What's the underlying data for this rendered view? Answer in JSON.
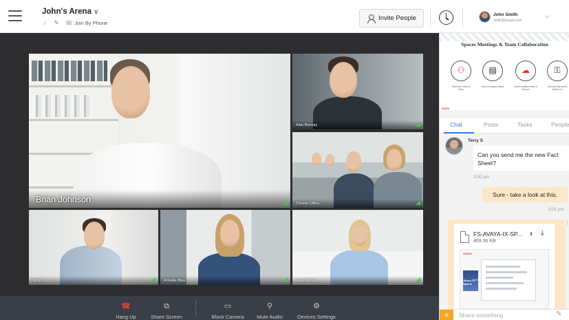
{
  "header": {
    "space_title": "John's Arena",
    "join_by_phone": "Join By Phone",
    "invite_label": "Invite People",
    "user_name": "John Smith",
    "user_email": "smith@avaya.com"
  },
  "video": {
    "main_speaker": "Brian Johnson",
    "tiles": [
      "Alan Bonnay",
      "Toronto Office",
      "Terry S",
      "Annette Blue",
      "Jane Porter"
    ]
  },
  "controls": [
    {
      "label": "Hang Up",
      "icon": "phone-hangup-icon"
    },
    {
      "label": "Share Screen",
      "icon": "share-screen-icon"
    },
    {
      "label": "Block Camera",
      "icon": "camera-icon"
    },
    {
      "label": "Mute Audio",
      "icon": "microphone-icon"
    },
    {
      "label": "Devices Settings",
      "icon": "gear-icon"
    }
  ],
  "banner": {
    "title": "Spaces Meetings & Team Collaboration",
    "features": [
      "Real-time voice & video",
      "Chat for today's teams",
      "Cloud enables ease of access",
      "Security that teams depend on"
    ],
    "brand": "AVAYA"
  },
  "tabs": [
    "Chat",
    "Posts",
    "Tasks",
    "People"
  ],
  "chat": {
    "sender": "Terry S",
    "msg_in": "Can you send me the new Fact Sheet?",
    "time_in": "3:00 pm",
    "msg_out": "Sure - take a look at this.",
    "time_out": "3:01 pm",
    "attachment": {
      "file_name": "FS-AVAYA-IX-SP...",
      "file_size": "469.36 KB",
      "preview_text": "Avaya IX™ Spaces"
    }
  },
  "compose": {
    "placeholder": "Share something"
  },
  "colors": {
    "accent_blue": "#2a7de1",
    "accent_orange": "#f5a623",
    "hangup_red": "#e8453c",
    "brand_red": "#d9342b"
  }
}
